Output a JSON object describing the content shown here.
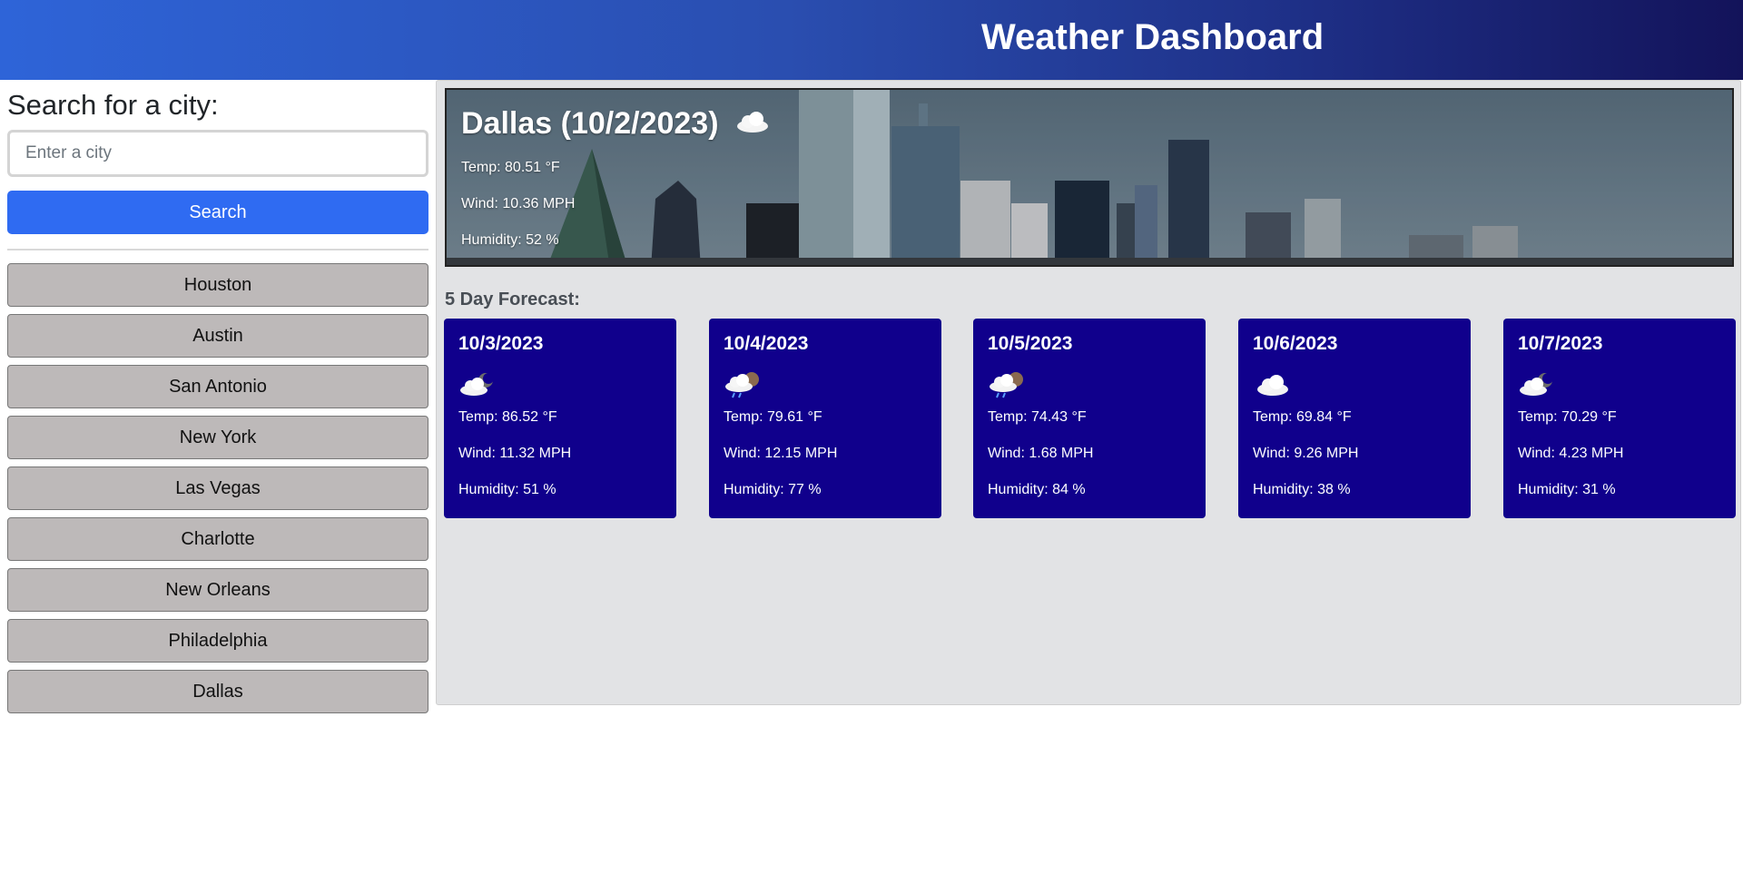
{
  "header": {
    "title": "Weather Dashboard"
  },
  "search": {
    "heading": "Search for a city:",
    "placeholder": "Enter a city",
    "value": "",
    "button_label": "Search"
  },
  "history": [
    "Houston",
    "Austin",
    "San Antonio",
    "New York",
    "Las Vegas",
    "Charlotte",
    "New Orleans",
    "Philadelphia",
    "Dallas"
  ],
  "current": {
    "title": "Dallas (10/2/2023)",
    "icon": "cloud-icon",
    "temp": "Temp: 80.51 °F",
    "wind": "Wind: 10.36 MPH",
    "humidity": "Humidity: 52 %"
  },
  "forecast": {
    "title": "5 Day Forecast:",
    "days": [
      {
        "date": "10/3/2023",
        "icon": "cloudy-night-icon",
        "temp": "Temp: 86.52 °F",
        "wind": "Wind: 11.32 MPH",
        "humidity": "Humidity: 51 %"
      },
      {
        "date": "10/4/2023",
        "icon": "rain-night-icon",
        "temp": "Temp: 79.61 °F",
        "wind": "Wind: 12.15 MPH",
        "humidity": "Humidity: 77 %"
      },
      {
        "date": "10/5/2023",
        "icon": "rain-night-icon",
        "temp": "Temp: 74.43 °F",
        "wind": "Wind: 1.68 MPH",
        "humidity": "Humidity: 84 %"
      },
      {
        "date": "10/6/2023",
        "icon": "cloud-icon",
        "temp": "Temp: 69.84 °F",
        "wind": "Wind: 9.26 MPH",
        "humidity": "Humidity: 38 %"
      },
      {
        "date": "10/7/2023",
        "icon": "cloudy-night-icon",
        "temp": "Temp: 70.29 °F",
        "wind": "Wind: 4.23 MPH",
        "humidity": "Humidity: 31 %"
      }
    ]
  },
  "colors": {
    "header_start": "#2e64d8",
    "header_end": "#13135a",
    "search_button": "#2f6bf2",
    "history_button": "#bdb9b9",
    "forecast_card": "#10008c",
    "main_panel": "#e2e3e5"
  }
}
